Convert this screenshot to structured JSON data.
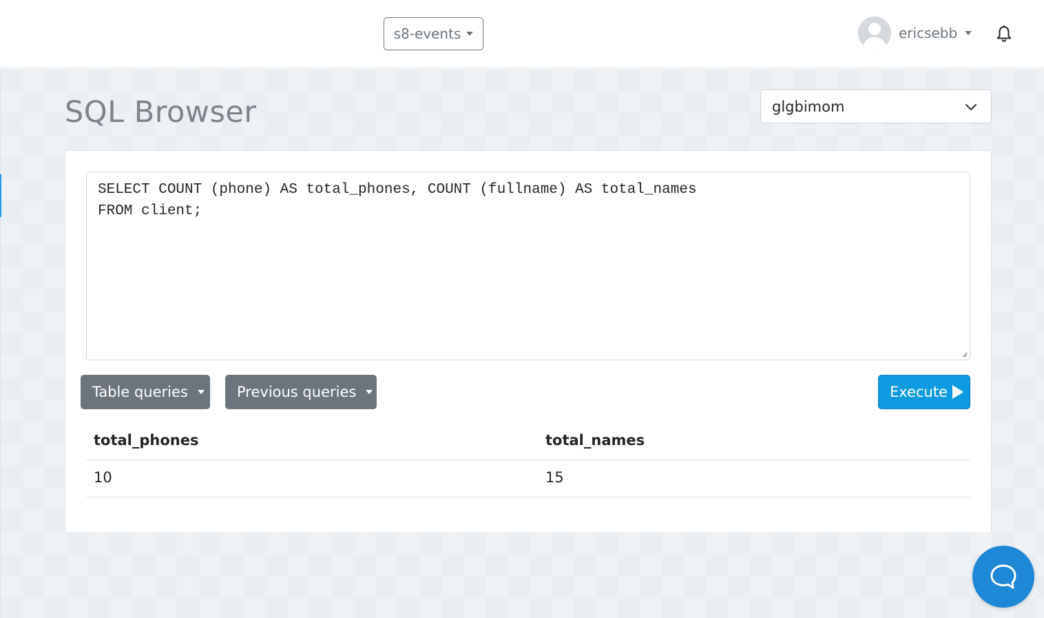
{
  "header": {
    "project_label": "s8-events",
    "username": "ericsebb",
    "icons": {
      "avatar": "user-avatar-icon",
      "notifications": "bell-icon"
    }
  },
  "page": {
    "title": "SQL Browser",
    "database_select": {
      "selected": "glgbimom"
    }
  },
  "editor": {
    "lines": [
      "SELECT COUNT (phone) AS total_phones, COUNT (fullname) AS total_names",
      "FROM client;"
    ]
  },
  "toolbar": {
    "table_queries_label": "Table queries",
    "previous_queries_label": "Previous queries",
    "execute_label": "Execute"
  },
  "results": {
    "columns": [
      "total_phones",
      "total_names"
    ],
    "rows": [
      [
        "10",
        "15"
      ]
    ]
  },
  "colors": {
    "accent": "#0d9ae0",
    "secondary_button": "#6c757d",
    "chat_button": "#1e87d6"
  }
}
